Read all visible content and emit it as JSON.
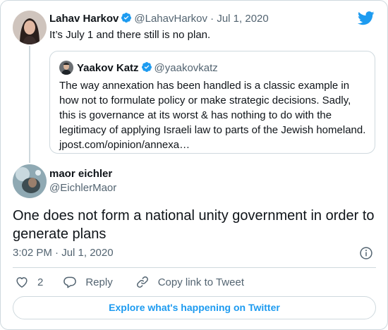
{
  "parent_tweet": {
    "author_name": "Lahav Harkov",
    "handle_and_date": "@LahavHarkov · Jul 1, 2020",
    "text": "It’s July 1 and there still is no plan."
  },
  "quoted_tweet": {
    "author_name": "Yaakov Katz",
    "handle": "@yaakovkatz",
    "lines": [
      "The way annexation has been handled is a classic example in",
      "how not to formulate policy or make strategic decisions. Sadly,",
      "this is governance at its worst & has nothing to do with the",
      "legitimacy of applying Israeli law to parts of the Jewish homeland.",
      "jpost.com/opinion/annexa…"
    ]
  },
  "main_tweet": {
    "author_name": "maor eichler",
    "handle": "@EichlerMaor",
    "text_lines": [
      "One does not form a national unity government in order to",
      "generate plans"
    ],
    "timestamp": "3:02 PM · Jul 1, 2020"
  },
  "actions": {
    "like_count": "2",
    "reply_label": "Reply",
    "copy_link_label": "Copy link to Tweet"
  },
  "explore_label": "Explore what's happening on Twitter",
  "icons": {
    "brand": "twitter-bird-icon",
    "verified": "verified-badge-icon",
    "info": "info-icon",
    "like": "heart-icon",
    "reply": "speech-bubble-icon",
    "link": "link-icon"
  },
  "colors": {
    "brand_blue": "#1d9bf0",
    "text_primary": "#0f1419",
    "text_secondary": "#536471",
    "border": "#cfd9de"
  }
}
